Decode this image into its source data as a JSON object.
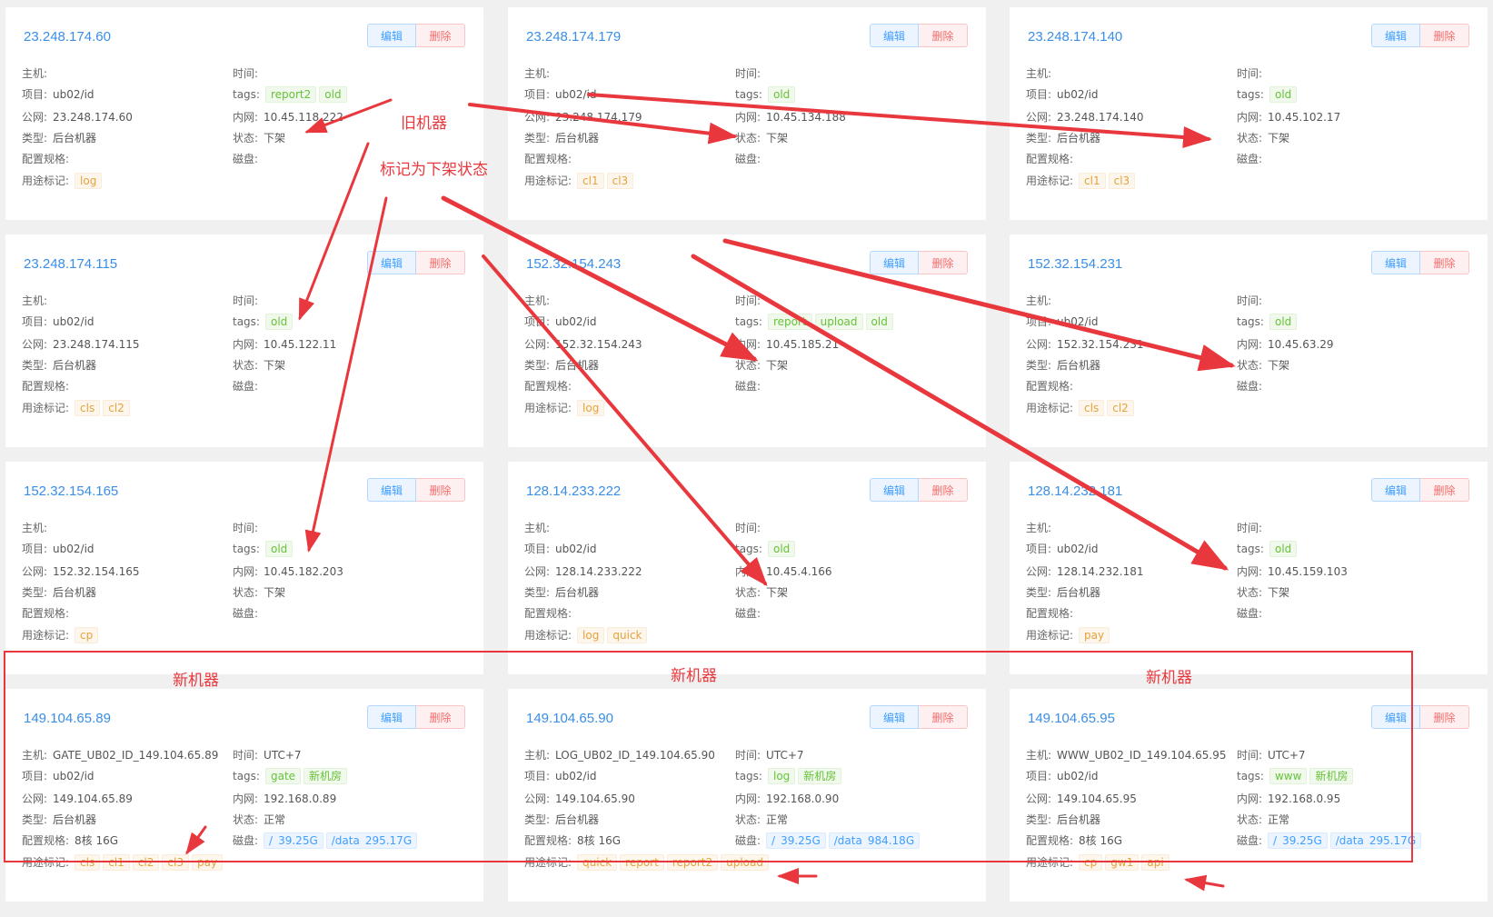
{
  "labels": {
    "host": "主机:",
    "project": "项目:",
    "public_ip": "公网:",
    "type": "类型:",
    "spec": "配置规格:",
    "purpose": "用途标记:",
    "time": "时间:",
    "tags": "tags:",
    "private_ip": "内网:",
    "status": "状态:",
    "disk": "磁盘:"
  },
  "buttons": {
    "edit": "编辑",
    "delete": "删除"
  },
  "cards": [
    {
      "ip": "23.248.174.60",
      "host": "",
      "project": "ub02/id",
      "public_ip": "23.248.174.60",
      "type": "后台机器",
      "spec": "",
      "purpose": [
        "log"
      ],
      "time": "",
      "tags": [
        "report2",
        "old"
      ],
      "private_ip": "10.45.118.222",
      "status": "下架",
      "disk": []
    },
    {
      "ip": "23.248.174.179",
      "host": "",
      "project": "ub02/id",
      "public_ip": "23.248.174.179",
      "type": "后台机器",
      "spec": "",
      "purpose": [
        "cl1",
        "cl3"
      ],
      "time": "",
      "tags": [
        "old"
      ],
      "private_ip": "10.45.134.188",
      "status": "下架",
      "disk": []
    },
    {
      "ip": "23.248.174.140",
      "host": "",
      "project": "ub02/id",
      "public_ip": "23.248.174.140",
      "type": "后台机器",
      "spec": "",
      "purpose": [
        "cl1",
        "cl3"
      ],
      "time": "",
      "tags": [
        "old"
      ],
      "private_ip": "10.45.102.17",
      "status": "下架",
      "disk": []
    },
    {
      "ip": "23.248.174.115",
      "host": "",
      "project": "ub02/id",
      "public_ip": "23.248.174.115",
      "type": "后台机器",
      "spec": "",
      "purpose": [
        "cls",
        "cl2"
      ],
      "time": "",
      "tags": [
        "old"
      ],
      "private_ip": "10.45.122.11",
      "status": "下架",
      "disk": []
    },
    {
      "ip": "152.32.154.243",
      "host": "",
      "project": "ub02/id",
      "public_ip": "152.32.154.243",
      "type": "后台机器",
      "spec": "",
      "purpose": [
        "log"
      ],
      "time": "",
      "tags": [
        "report",
        "upload",
        "old"
      ],
      "private_ip": "10.45.185.21",
      "status": "下架",
      "disk": []
    },
    {
      "ip": "152.32.154.231",
      "host": "",
      "project": "ub02/id",
      "public_ip": "152.32.154.231",
      "type": "后台机器",
      "spec": "",
      "purpose": [
        "cls",
        "cl2"
      ],
      "time": "",
      "tags": [
        "old"
      ],
      "private_ip": "10.45.63.29",
      "status": "下架",
      "disk": []
    },
    {
      "ip": "152.32.154.165",
      "host": "",
      "project": "ub02/id",
      "public_ip": "152.32.154.165",
      "type": "后台机器",
      "spec": "",
      "purpose": [
        "cp"
      ],
      "time": "",
      "tags": [
        "old"
      ],
      "private_ip": "10.45.182.203",
      "status": "下架",
      "disk": []
    },
    {
      "ip": "128.14.233.222",
      "host": "",
      "project": "ub02/id",
      "public_ip": "128.14.233.222",
      "type": "后台机器",
      "spec": "",
      "purpose": [
        "log",
        "quick"
      ],
      "time": "",
      "tags": [
        "old"
      ],
      "private_ip": "10.45.4.166",
      "status": "下架",
      "disk": []
    },
    {
      "ip": "128.14.232.181",
      "host": "",
      "project": "ub02/id",
      "public_ip": "128.14.232.181",
      "type": "后台机器",
      "spec": "",
      "purpose": [
        "pay"
      ],
      "time": "",
      "tags": [
        "old"
      ],
      "private_ip": "10.45.159.103",
      "status": "下架",
      "disk": []
    },
    {
      "ip": "149.104.65.89",
      "host": "GATE_UB02_ID_149.104.65.89",
      "project": "ub02/id",
      "public_ip": "149.104.65.89",
      "type": "后台机器",
      "spec": "8核 16G",
      "purpose": [
        "cls",
        "cl1",
        "cl2",
        "cl3",
        "pay"
      ],
      "time": "UTC+7",
      "tags": [
        "gate",
        "新机房"
      ],
      "private_ip": "192.168.0.89",
      "status": "正常",
      "disk": [
        {
          "mount": "/",
          "size": "39.25G"
        },
        {
          "mount": "/data",
          "size": "295.17G"
        }
      ]
    },
    {
      "ip": "149.104.65.90",
      "host": "LOG_UB02_ID_149.104.65.90",
      "project": "ub02/id",
      "public_ip": "149.104.65.90",
      "type": "后台机器",
      "spec": "8核 16G",
      "purpose": [
        "quick",
        "report",
        "report2",
        "upload"
      ],
      "time": "UTC+7",
      "tags": [
        "log",
        "新机房"
      ],
      "private_ip": "192.168.0.90",
      "status": "正常",
      "disk": [
        {
          "mount": "/",
          "size": "39.25G"
        },
        {
          "mount": "/data",
          "size": "984.18G"
        }
      ]
    },
    {
      "ip": "149.104.65.95",
      "host": "WWW_UB02_ID_149.104.65.95",
      "project": "ub02/id",
      "public_ip": "149.104.65.95",
      "type": "后台机器",
      "spec": "8核 16G",
      "purpose": [
        "cp",
        "gw1",
        "api"
      ],
      "time": "UTC+7",
      "tags": [
        "www",
        "新机房"
      ],
      "private_ip": "192.168.0.95",
      "status": "正常",
      "disk": [
        {
          "mount": "/",
          "size": "39.25G"
        },
        {
          "mount": "/data",
          "size": "295.17G"
        }
      ]
    }
  ],
  "annotations": {
    "old_machines": "旧机器",
    "mark_offline": "标记为下架状态",
    "new_machine": "新机器"
  },
  "colors": {
    "accent_blue": "#3a8ee6",
    "annotation_red": "#e8383d",
    "tag_green": "#67c23a",
    "tag_orange": "#e6a23c"
  }
}
